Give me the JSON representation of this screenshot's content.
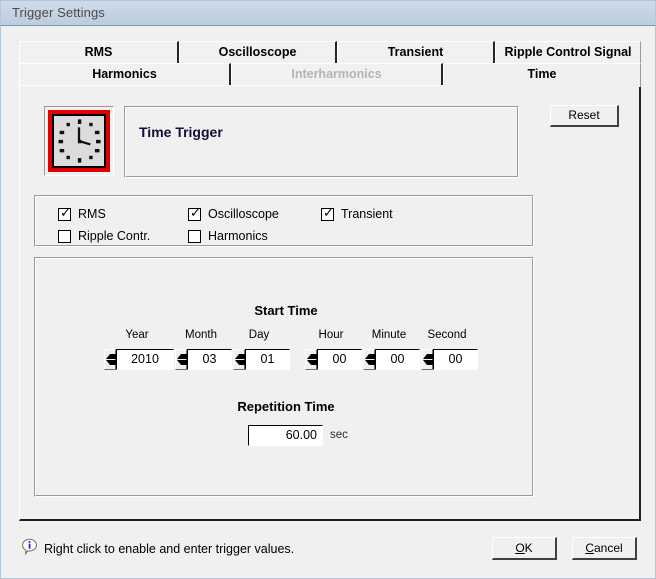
{
  "window": {
    "title": "Trigger Settings"
  },
  "tabs": {
    "row1": [
      {
        "label": "RMS",
        "selected": false,
        "disabled": false
      },
      {
        "label": "Oscilloscope",
        "selected": false,
        "disabled": false
      },
      {
        "label": "Transient",
        "selected": false,
        "disabled": false
      },
      {
        "label": "Ripple Control Signal",
        "selected": false,
        "disabled": false
      }
    ],
    "row2": [
      {
        "label": "Harmonics",
        "selected": false,
        "disabled": false
      },
      {
        "label": "Interharmonics",
        "selected": false,
        "disabled": true
      },
      {
        "label": "Time",
        "selected": true,
        "disabled": false
      }
    ]
  },
  "header": {
    "icon": "clock-icon",
    "trigger_title": "Time Trigger",
    "reset_label": "Reset"
  },
  "checkboxes": [
    {
      "label": "RMS",
      "checked": true
    },
    {
      "label": "Oscilloscope",
      "checked": true
    },
    {
      "label": "Transient",
      "checked": true
    },
    {
      "label": "Ripple Contr.",
      "checked": false
    },
    {
      "label": "Harmonics",
      "checked": false
    }
  ],
  "start_time": {
    "title": "Start Time",
    "fields": [
      {
        "label": "Year",
        "value": "2010"
      },
      {
        "label": "Month",
        "value": "03"
      },
      {
        "label": "Day",
        "value": "01"
      },
      {
        "label": "Hour",
        "value": "00"
      },
      {
        "label": "Minute",
        "value": "00"
      },
      {
        "label": "Second",
        "value": "00"
      }
    ]
  },
  "repetition": {
    "title": "Repetition Time",
    "value": "60.00",
    "unit": "sec"
  },
  "footer": {
    "hint_icon": "info-icon",
    "hint": "Right click to enable and enter trigger values.",
    "ok_label": "OK",
    "ok_accel": "O",
    "cancel_label": "Cancel",
    "cancel_accel": "C"
  },
  "colors": {
    "titlebar": "#c3d2e3",
    "dialog_face": "#f0f0f0",
    "clock_frame": "#e00000",
    "info_blue": "#2222cc"
  }
}
